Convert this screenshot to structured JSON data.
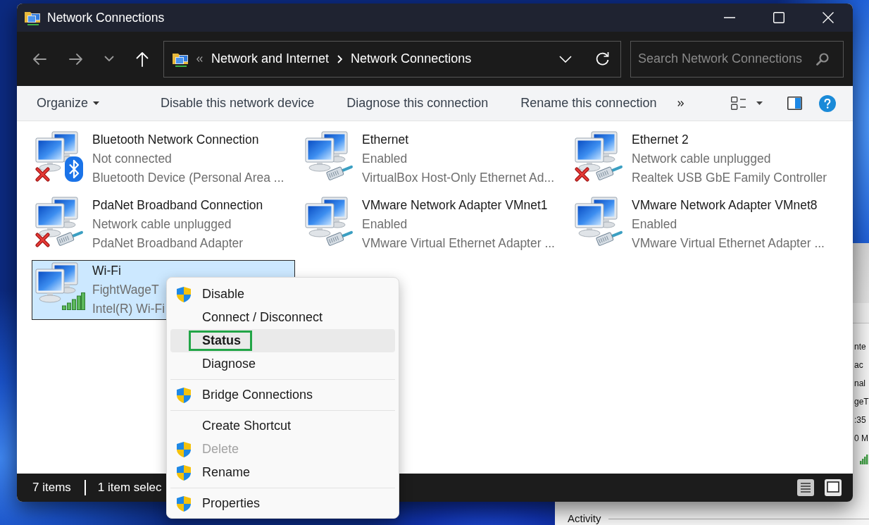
{
  "window": {
    "title": "Network Connections"
  },
  "navigation": [
    {
      "kind": "back",
      "disabled": true
    },
    {
      "kind": "forward",
      "disabled": true
    },
    {
      "kind": "recent",
      "disabled": true
    },
    {
      "kind": "up",
      "disabled": false
    }
  ],
  "address_bar": {
    "crumbs": [
      {
        "label": "Network and Internet"
      },
      {
        "label": "Network Connections"
      }
    ]
  },
  "search": {
    "placeholder": "Search Network Connections"
  },
  "command_bar": {
    "organize": "Organize",
    "commands": [
      {
        "label": "Disable this network device"
      },
      {
        "label": "Diagnose this connection"
      },
      {
        "label": "Rename this connection"
      }
    ]
  },
  "connections": [
    {
      "name": "Bluetooth Network Connection",
      "status": "Not connected",
      "device": "Bluetooth Device (Personal Area ...",
      "kind": "bluetooth",
      "disconnected": true,
      "selected": false
    },
    {
      "name": "Ethernet",
      "status": "Enabled",
      "device": "VirtualBox Host-Only Ethernet Ad...",
      "kind": "ethernet",
      "disconnected": false,
      "selected": false
    },
    {
      "name": "Ethernet 2",
      "status": "Network cable unplugged",
      "device": "Realtek USB GbE Family Controller",
      "kind": "ethernet",
      "disconnected": true,
      "selected": false
    },
    {
      "name": "PdaNet Broadband Connection",
      "status": "Network cable unplugged",
      "device": "PdaNet Broadband Adapter",
      "kind": "ethernet",
      "disconnected": true,
      "selected": false
    },
    {
      "name": "VMware Network Adapter VMnet1",
      "status": "Enabled",
      "device": "VMware Virtual Ethernet Adapter ...",
      "kind": "ethernet",
      "disconnected": false,
      "selected": false
    },
    {
      "name": "VMware Network Adapter VMnet8",
      "status": "Enabled",
      "device": "VMware Virtual Ethernet Adapter ...",
      "kind": "ethernet",
      "disconnected": false,
      "selected": false
    },
    {
      "name": "Wi-Fi",
      "status": "FightWageT",
      "device": "Intel(R) Wi-Fi",
      "kind": "wifi",
      "disconnected": false,
      "selected": true
    }
  ],
  "status_bar": {
    "item_count": "7 items",
    "selection": "1 item selec"
  },
  "context_menu": {
    "groups": [
      {
        "items": [
          {
            "label": "Disable",
            "kind": "elevated",
            "selected": false,
            "default": false,
            "disabled": false
          },
          {
            "label": "Connect / Disconnect",
            "kind": "plain",
            "selected": false,
            "default": false,
            "disabled": false
          },
          {
            "label": "Status",
            "kind": "plain",
            "selected": true,
            "default": true,
            "disabled": false
          },
          {
            "label": "Diagnose",
            "kind": "plain",
            "selected": false,
            "default": false,
            "disabled": false
          }
        ]
      },
      {
        "items": [
          {
            "label": "Bridge Connections",
            "kind": "elevated",
            "selected": false,
            "default": false,
            "disabled": false
          }
        ]
      },
      {
        "items": [
          {
            "label": "Create Shortcut",
            "kind": "plain",
            "selected": false,
            "default": false,
            "disabled": false
          },
          {
            "label": "Delete",
            "kind": "elevated",
            "selected": false,
            "default": false,
            "disabled": true
          },
          {
            "label": "Rename",
            "kind": "elevated",
            "selected": false,
            "default": false,
            "disabled": false
          }
        ]
      },
      {
        "items": [
          {
            "label": "Properties",
            "kind": "elevated",
            "selected": false,
            "default": false,
            "disabled": false
          }
        ]
      }
    ]
  },
  "background_window": {
    "details": [
      "nte",
      "ac",
      "nal",
      "geT",
      ":35",
      "0 M"
    ],
    "section": "Activity"
  }
}
